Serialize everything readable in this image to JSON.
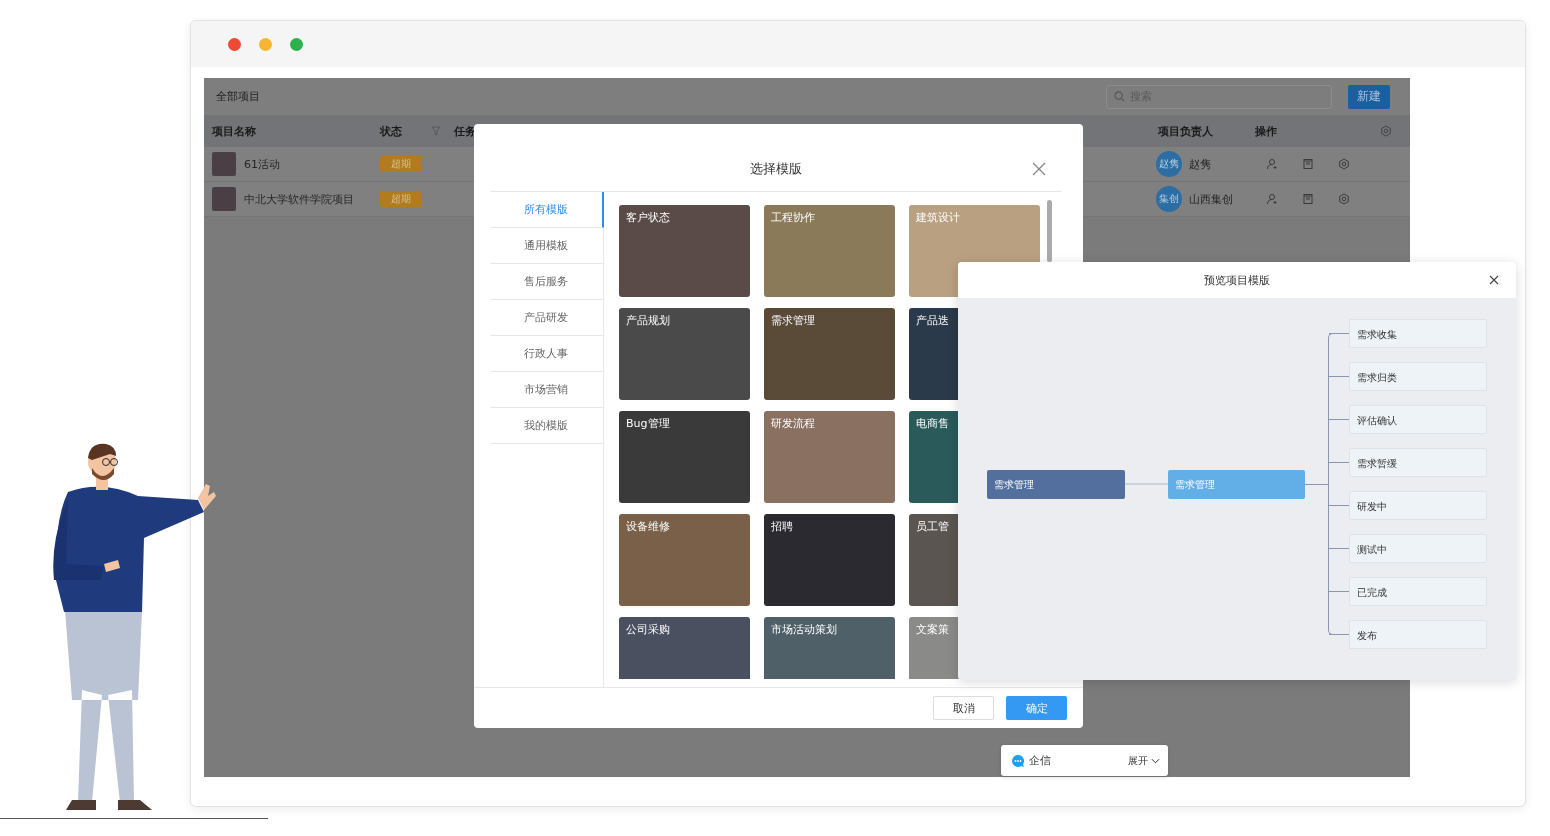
{
  "window_controls": [
    {
      "color": "#ee4b36"
    },
    {
      "color": "#f5b731"
    },
    {
      "color": "#2bb24c"
    }
  ],
  "app": {
    "title": "全部项目",
    "search": {
      "placeholder": "搜索"
    },
    "new_button": "新建",
    "columns": [
      "项目名称",
      "状态",
      "任务",
      "项目负责人",
      "操作"
    ],
    "rows": [
      {
        "name": "61活动",
        "status": "超期",
        "owner_initials": "赵隽",
        "owner": "赵隽"
      },
      {
        "name": "中北大学软件学院项目",
        "status": "超期",
        "owner_initials": "集创",
        "owner": "山西集创"
      }
    ]
  },
  "template_dialog": {
    "title": "选择模版",
    "categories": [
      {
        "label": "所有模版",
        "selected": true
      },
      {
        "label": "通用模板",
        "selected": false
      },
      {
        "label": "售后服务",
        "selected": false
      },
      {
        "label": "产品研发",
        "selected": false
      },
      {
        "label": "行政人事",
        "selected": false
      },
      {
        "label": "市场营销",
        "selected": false
      },
      {
        "label": "我的模版",
        "selected": false
      }
    ],
    "templates": [
      "客户状态",
      "工程协作",
      "建筑设计",
      "产品规划",
      "需求管理",
      "产品迭",
      "Bug管理",
      "研发流程",
      "电商售",
      "设备维修",
      "招聘",
      "员工管",
      "公司采购",
      "市场活动策划",
      "文案策"
    ],
    "cancel_button": "取消",
    "ok_button": "确定"
  },
  "preview": {
    "title": "预览项目模版",
    "root": "需求管理",
    "branch": "需求管理",
    "stages": [
      "需求收集",
      "需求归类",
      "评估确认",
      "需求暂缓",
      "研发中",
      "测试中",
      "已完成",
      "发布"
    ]
  },
  "chat_widget": {
    "label": "企信",
    "expand": "展开"
  }
}
